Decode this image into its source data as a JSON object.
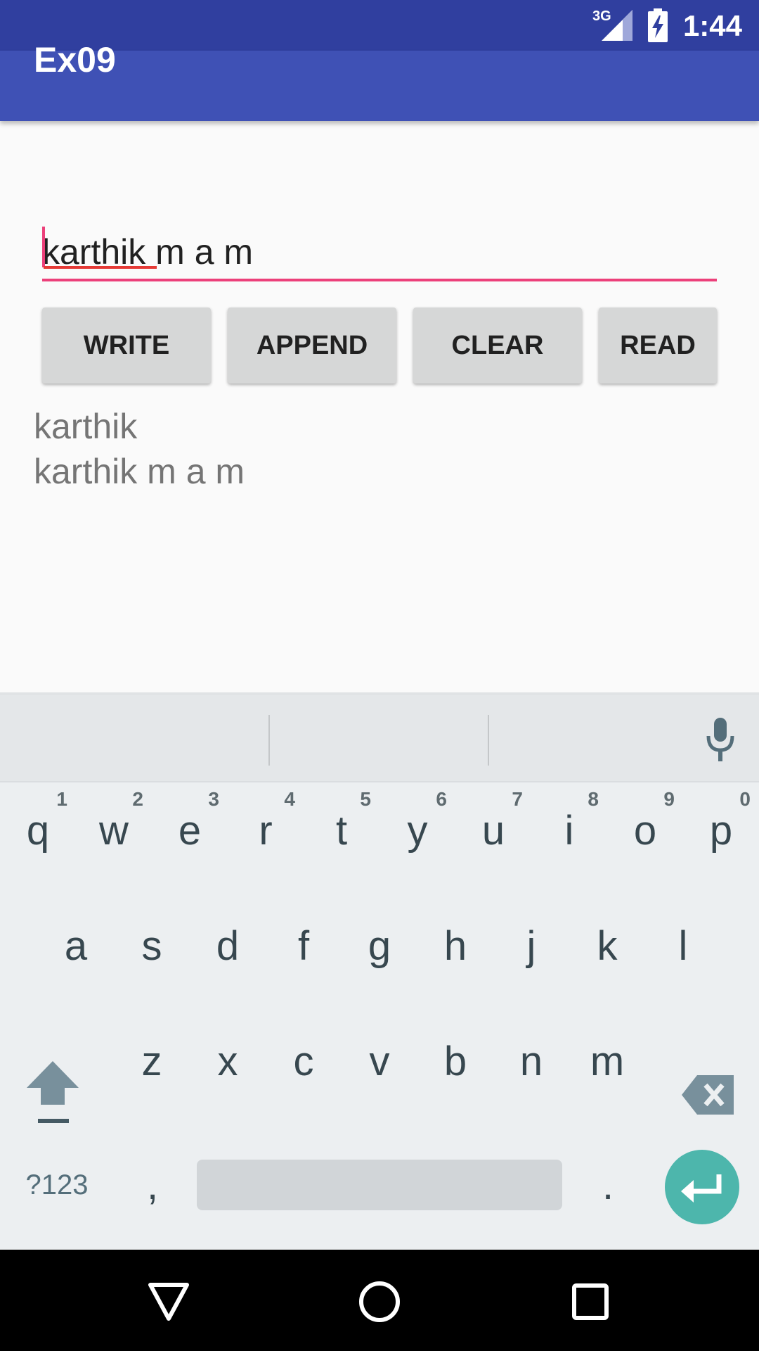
{
  "status_bar": {
    "time": "1:44",
    "network": "3G"
  },
  "toolbar": {
    "title": "Ex09"
  },
  "input": {
    "value": "karthik m a m"
  },
  "buttons": {
    "write": "WRITE",
    "append": "APPEND",
    "clear": "CLEAR",
    "read": "READ"
  },
  "output": {
    "text": "karthik\nkarthik m a m"
  },
  "keyboard": {
    "row1": [
      {
        "k": "q",
        "n": "1"
      },
      {
        "k": "w",
        "n": "2"
      },
      {
        "k": "e",
        "n": "3"
      },
      {
        "k": "r",
        "n": "4"
      },
      {
        "k": "t",
        "n": "5"
      },
      {
        "k": "y",
        "n": "6"
      },
      {
        "k": "u",
        "n": "7"
      },
      {
        "k": "i",
        "n": "8"
      },
      {
        "k": "o",
        "n": "9"
      },
      {
        "k": "p",
        "n": "0"
      }
    ],
    "row2": [
      "a",
      "s",
      "d",
      "f",
      "g",
      "h",
      "j",
      "k",
      "l"
    ],
    "row3": [
      "z",
      "x",
      "c",
      "v",
      "b",
      "n",
      "m"
    ],
    "symbols_label": "?123",
    "comma": ",",
    "period": "."
  },
  "colors": {
    "primary": "#3f51b5",
    "primary_dark": "#303f9f",
    "accent": "#ec407a",
    "enter": "#4db6ac"
  }
}
